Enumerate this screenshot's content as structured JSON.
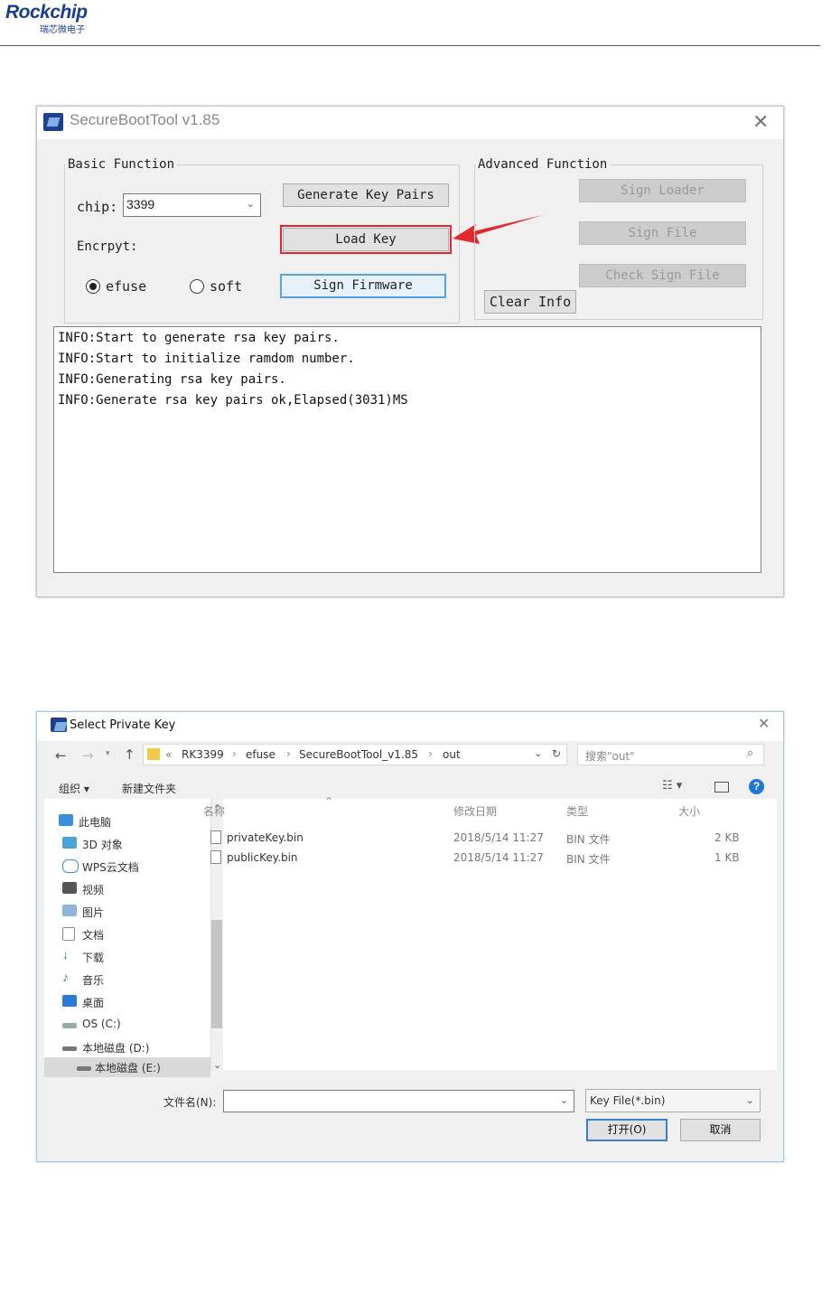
{
  "header": {
    "logo_text": "Rockchip",
    "logo_sub": "瑞芯微电子"
  },
  "securebootool": {
    "title": "SecureBootTool v1.85",
    "close": "✕",
    "basic_group": "Basic Function",
    "advanced_group": "Advanced Function",
    "chip_label": "chip:",
    "chip_value": "3399",
    "encrypt_label": "Encrpyt:",
    "radio_efuse": "efuse",
    "radio_soft": "soft",
    "btn_generate": "Generate Key Pairs",
    "btn_load": "Load Key",
    "btn_sign_firmware": "Sign Firmware",
    "btn_clear": "Clear Info",
    "btn_sign_loader": "Sign Loader",
    "btn_sign_file": "Sign File",
    "btn_check_sign": "Check Sign File",
    "log": [
      "INFO:Start to generate rsa key pairs.",
      "INFO:Start to initialize ramdom number.",
      "INFO:Generating rsa key pairs.",
      "INFO:Generate rsa key pairs ok,Elapsed(3031)MS"
    ],
    "annotation_color": "#e0282e"
  },
  "dialog": {
    "title": "Select Private Key",
    "close": "✕",
    "breadcrumb": [
      "«",
      "RK3399",
      "›",
      "efuse",
      "›",
      "SecureBootTool_v1.85",
      "›",
      "out"
    ],
    "search_placeholder": "搜索\"out\"",
    "toolbar_organize": "组织 ▾",
    "toolbar_new_folder": "新建文件夹",
    "nav_items": [
      "此电脑",
      "3D 对象",
      "WPS云文档",
      "视频",
      "图片",
      "文档",
      "下载",
      "音乐",
      "桌面",
      "OS (C:)",
      "本地磁盘 (D:)",
      "本地磁盘 (E:)"
    ],
    "columns": [
      "名称",
      "修改日期",
      "类型",
      "大小"
    ],
    "files": [
      {
        "name": "privateKey.bin",
        "date": "2018/5/14 11:27",
        "type": "BIN 文件",
        "size": "2 KB"
      },
      {
        "name": "publicKey.bin",
        "date": "2018/5/14 11:27",
        "type": "BIN 文件",
        "size": "1 KB"
      }
    ],
    "filename_label": "文件名(N):",
    "filename_value": "",
    "filter_value": "Key File(*.bin)",
    "btn_open": "打开(O)",
    "btn_cancel": "取消"
  }
}
